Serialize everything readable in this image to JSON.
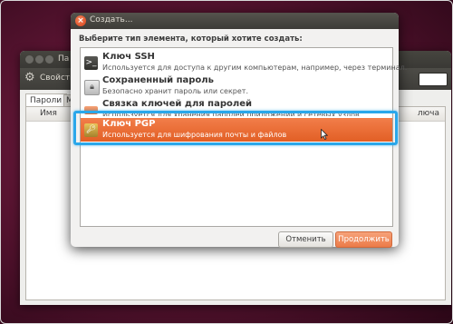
{
  "background_window": {
    "title": "Па",
    "toolbar_label": "Свойств",
    "tabs": [
      "Пароли",
      "М"
    ],
    "columns": {
      "name": "Имя",
      "key": "лючa"
    }
  },
  "dialog": {
    "title": "Создать...",
    "prompt": "Выберите тип элемента, который хотите создать:",
    "items": [
      {
        "title": "Ключ SSH",
        "description": "Используется для доступа к другим компьютерам, например, через терминал.",
        "icon": "terminal-icon",
        "selected": false
      },
      {
        "title": "Сохраненный пароль",
        "description": "Безопасно хранит пароль или секрет.",
        "icon": "lock-icon",
        "selected": false
      },
      {
        "title": "Связка ключей для паролей",
        "description": "Используется для хранения паролей приложений и сетевых узлов",
        "icon": "keyring-icon",
        "selected": false
      },
      {
        "title": "Ключ PGP",
        "description": "Используется для шифрования почты и файлов",
        "icon": "pgp-key-icon",
        "selected": true
      }
    ],
    "buttons": {
      "cancel": "Отменить",
      "continue": "Продолжить"
    }
  },
  "colors": {
    "selection": "#e8682f",
    "highlight_box": "#2aa7ea",
    "accent_button": "#ec7b48"
  }
}
